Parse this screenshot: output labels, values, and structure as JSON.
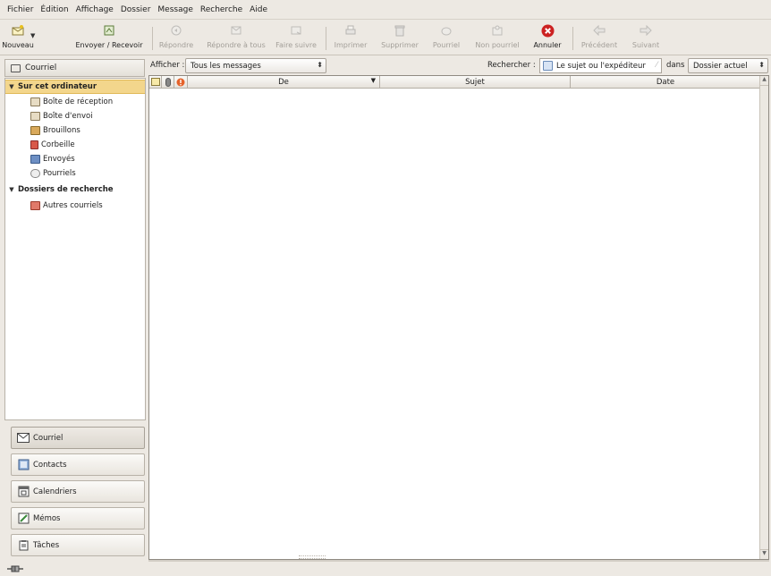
{
  "menubar": {
    "items": [
      "Fichier",
      "Édition",
      "Affichage",
      "Dossier",
      "Message",
      "Recherche",
      "Aide"
    ]
  },
  "toolbar": {
    "new_label": "Nouveau",
    "send_receive_label": "Envoyer / Recevoir",
    "reply_label": "Répondre",
    "reply_all_label": "Répondre à tous",
    "forward_label": "Faire suivre",
    "print_label": "Imprimer",
    "delete_label": "Supprimer",
    "junk_label": "Pourriel",
    "not_junk_label": "Non pourriel",
    "cancel_label": "Annuler",
    "previous_label": "Précédent",
    "next_label": "Suivant",
    "cancel_color": "#cc2222"
  },
  "sidebar": {
    "header": "Courriel",
    "groups": [
      {
        "label": "Sur cet ordinateur",
        "selected": true,
        "items": [
          "Boîte de réception",
          "Boîte d'envoi",
          "Brouillons",
          "Corbeille",
          "Envoyés",
          "Pourriels"
        ]
      },
      {
        "label": "Dossiers de recherche",
        "selected": false,
        "items": [
          "Autres courriels"
        ]
      }
    ],
    "switchers": [
      "Courriel",
      "Contacts",
      "Calendriers",
      "Mémos",
      "Tâches"
    ],
    "selected_color": "#f3d68c"
  },
  "filter": {
    "show_label": "Afficher :",
    "show_value": "Tous les messages",
    "search_label": "Rechercher :",
    "search_value": "Le sujet ou l'expéditeur",
    "in_label": "dans",
    "scope_value": "Dossier actuel"
  },
  "messages": {
    "columns": [
      "De",
      "Sujet",
      "Date"
    ],
    "rows": []
  }
}
